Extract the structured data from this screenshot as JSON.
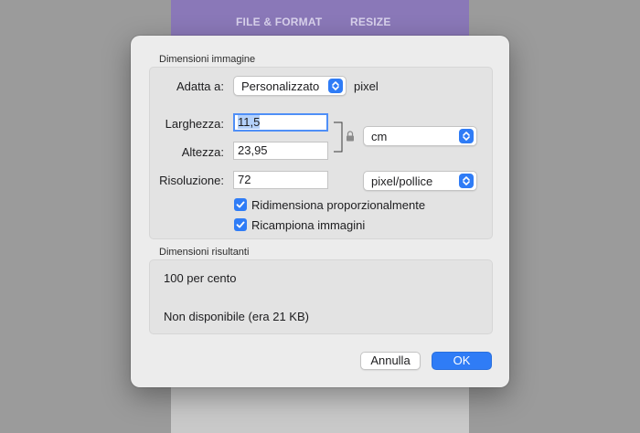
{
  "background": {
    "tabs": [
      "FILE & FORMAT",
      "RESIZE"
    ]
  },
  "dialog": {
    "image_dimensions": {
      "title": "Dimensioni immagine",
      "fit_label": "Adatta a:",
      "fit_value": "Personalizzato",
      "fit_unit": "pixel",
      "width_label": "Larghezza:",
      "width_value": "11,5",
      "height_label": "Altezza:",
      "height_value": "23,95",
      "size_unit": "cm",
      "resolution_label": "Risoluzione:",
      "resolution_value": "72",
      "resolution_unit": "pixel/pollice",
      "scale_proportionally": {
        "label": "Ridimensiona proporzionalmente",
        "checked": true
      },
      "resample": {
        "label": "Ricampiona immagini",
        "checked": true
      }
    },
    "resulting_dimensions": {
      "title": "Dimensioni risultanti",
      "percent": "100 per cento",
      "size": "Non disponibile (era 21 KB)"
    },
    "buttons": {
      "cancel": "Annulla",
      "ok": "OK"
    }
  },
  "colors": {
    "accent": "#2f7cf6",
    "header": "#8a78b8",
    "dialog_bg": "#ececec"
  }
}
